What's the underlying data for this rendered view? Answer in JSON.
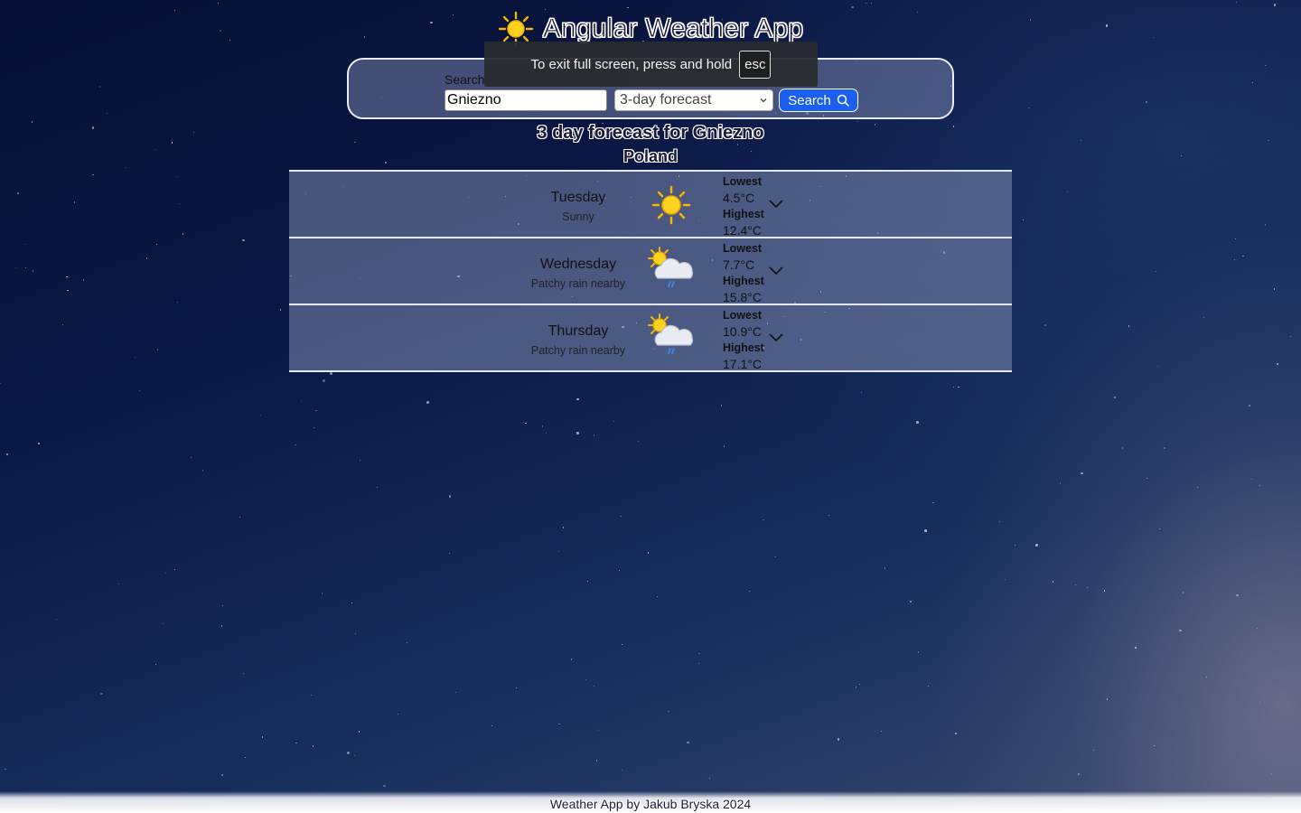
{
  "header": {
    "title": "Angular Weather App",
    "logo_icon": "sun-icon"
  },
  "search": {
    "label": "Search",
    "value": "Gniezno",
    "forecast_select": {
      "selected": "3-day forecast"
    },
    "button_label": "Search",
    "button_icon": "search-icon"
  },
  "fullscreen_notice": {
    "text": "To exit full screen, press and hold",
    "key": "esc"
  },
  "forecast": {
    "heading": "3 day forecast for Gniezno",
    "country": "Poland",
    "lowest_label": "Lowest",
    "highest_label": "Highest",
    "days": [
      {
        "day": "Tuesday",
        "condition": "Sunny",
        "icon": "sun-icon",
        "lowest": "4.5°C",
        "highest": "12.4°C"
      },
      {
        "day": "Wednesday",
        "condition": "Patchy rain nearby",
        "icon": "partly-cloudy-rain-icon",
        "lowest": "7.7°C",
        "highest": "15.8°C"
      },
      {
        "day": "Thursday",
        "condition": "Patchy rain nearby",
        "icon": "partly-cloudy-rain-icon",
        "lowest": "10.9°C",
        "highest": "17.1°C"
      }
    ]
  },
  "footer": {
    "text": "Weather App by Jakub Bryska 2024"
  },
  "colors": {
    "accent": "#1a5ff0",
    "panel_border": "#e9ecf4"
  }
}
